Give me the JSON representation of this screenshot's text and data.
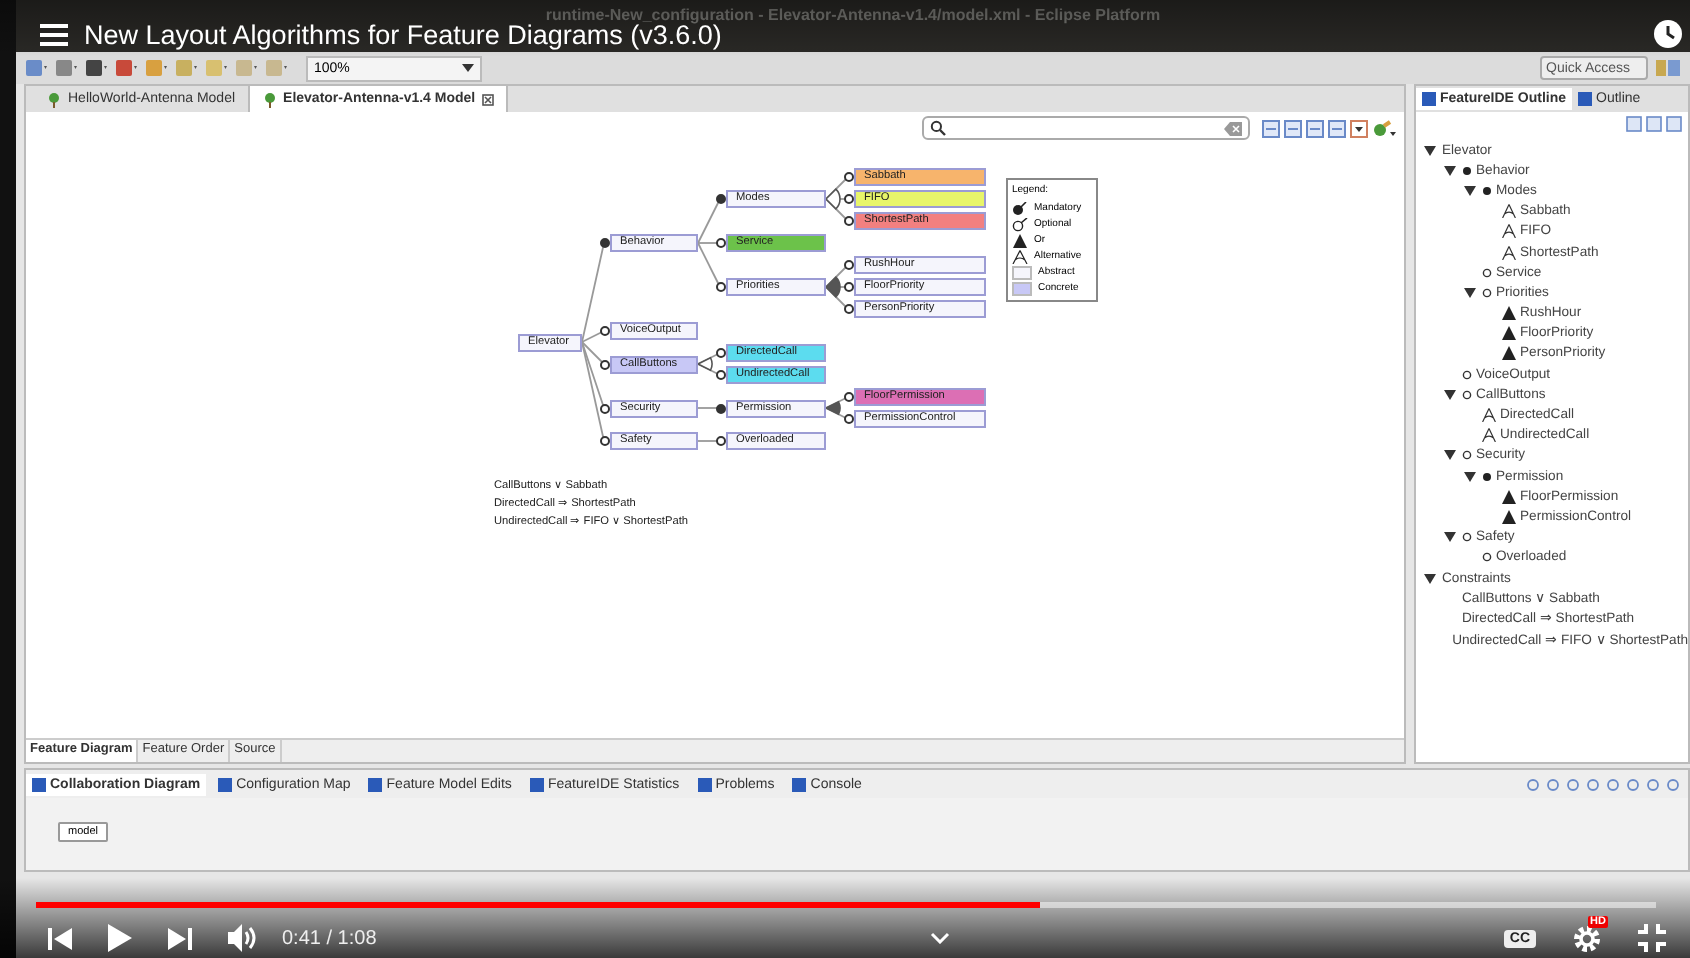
{
  "video": {
    "title": "New Layout Algorithms for Feature Diagrams (v3.6.0)",
    "time": "0:41 / 1:08",
    "progress": {
      "level": 0.62
    },
    "cc": "CC",
    "quality_badge": "HD"
  },
  "window": {
    "title": "runtime-New_configuration - Elevator-Antenna-v1.4/model.xml - Eclipse Platform"
  },
  "toolbar": {
    "zoom": "100%",
    "quick_access": {
      "placeholder": "Quick Access"
    }
  },
  "editor": {
    "tabs": [
      {
        "label": "HelloWorld-Antenna Model",
        "selected": false
      },
      {
        "label": "Elevator-Antenna-v1.4 Model",
        "selected": true
      }
    ],
    "diagram": {
      "root": {
        "name": "Elevator",
        "concrete": false,
        "children": [
          {
            "name": "Behavior",
            "kind": "mandatory",
            "concrete": false,
            "children": [
              {
                "name": "Modes",
                "kind": "mandatory",
                "or_group": false,
                "concrete": false,
                "children": [
                  {
                    "name": "Sabbath",
                    "kind": "optional",
                    "color": "#f7b46c"
                  },
                  {
                    "name": "FIFO",
                    "kind": "optional",
                    "color": "#e8f56a"
                  },
                  {
                    "name": "ShortestPath",
                    "kind": "optional",
                    "color": "#f28080"
                  }
                ]
              },
              {
                "name": "Service",
                "kind": "optional",
                "color": "#6cc24a"
              },
              {
                "name": "Priorities",
                "kind": "optional",
                "or_group": true,
                "concrete": false,
                "children": [
                  {
                    "name": "RushHour",
                    "kind": "optional",
                    "concrete": false
                  },
                  {
                    "name": "FloorPriority",
                    "kind": "optional",
                    "concrete": false
                  },
                  {
                    "name": "PersonPriority",
                    "kind": "optional",
                    "concrete": false
                  }
                ]
              }
            ]
          },
          {
            "name": "VoiceOutput",
            "kind": "optional",
            "concrete": false
          },
          {
            "name": "CallButtons",
            "kind": "optional",
            "or_group": false,
            "concrete": true,
            "children": [
              {
                "name": "DirectedCall",
                "kind": "optional",
                "color": "#5cdcef"
              },
              {
                "name": "UndirectedCall",
                "kind": "optional",
                "color": "#5cdcef"
              }
            ]
          },
          {
            "name": "Security",
            "kind": "optional",
            "concrete": false,
            "children": [
              {
                "name": "Permission",
                "kind": "mandatory",
                "or_group": true,
                "concrete": false,
                "children": [
                  {
                    "name": "FloorPermission",
                    "kind": "optional",
                    "color": "#dc6fb4"
                  },
                  {
                    "name": "PermissionControl",
                    "kind": "optional",
                    "concrete": false
                  }
                ]
              }
            ]
          },
          {
            "name": "Safety",
            "kind": "optional",
            "concrete": false,
            "children": [
              {
                "name": "Overloaded",
                "kind": "optional",
                "concrete": false
              }
            ]
          }
        ]
      },
      "legend": {
        "title": "Legend:",
        "items": [
          {
            "kind": "mandatory",
            "label": "Mandatory"
          },
          {
            "kind": "optional",
            "label": "Optional"
          },
          {
            "kind": "or",
            "label": "Or"
          },
          {
            "kind": "alternative",
            "label": "Alternative"
          },
          {
            "kind": "abstract",
            "label": "Abstract"
          },
          {
            "kind": "concrete",
            "label": "Concrete"
          }
        ]
      },
      "constraints": [
        "CallButtons ∨ Sabbath",
        "DirectedCall ⇒ ShortestPath",
        "UndirectedCall ⇒ FIFO ∨ ShortestPath"
      ]
    },
    "bottom_tabs": [
      {
        "label": "Feature Diagram",
        "selected": true
      },
      {
        "label": "Feature Order",
        "selected": false
      },
      {
        "label": "Source",
        "selected": false
      }
    ]
  },
  "outline": {
    "tabs": [
      {
        "label": "FeatureIDE Outline",
        "selected": true
      },
      {
        "label": "Outline",
        "selected": false
      }
    ],
    "items": [
      {
        "label": "Elevator",
        "expanded": true,
        "children": [
          {
            "label": "Behavior",
            "kind": "mandatory",
            "expanded": true,
            "children": [
              {
                "label": "Modes",
                "kind": "mandatory",
                "expanded": true,
                "children": [
                  {
                    "label": "Sabbath",
                    "kind": "alternative"
                  },
                  {
                    "label": "FIFO",
                    "kind": "alternative"
                  },
                  {
                    "label": "ShortestPath",
                    "kind": "alternative"
                  }
                ]
              },
              {
                "label": "Service",
                "kind": "optional"
              },
              {
                "label": "Priorities",
                "kind": "optional",
                "expanded": true,
                "children": [
                  {
                    "label": "RushHour",
                    "kind": "or"
                  },
                  {
                    "label": "FloorPriority",
                    "kind": "or"
                  },
                  {
                    "label": "PersonPriority",
                    "kind": "or"
                  }
                ]
              }
            ]
          },
          {
            "label": "VoiceOutput",
            "kind": "optional"
          },
          {
            "label": "CallButtons",
            "kind": "optional",
            "expanded": true,
            "children": [
              {
                "label": "DirectedCall",
                "kind": "alternative"
              },
              {
                "label": "UndirectedCall",
                "kind": "alternative"
              }
            ]
          },
          {
            "label": "Security",
            "kind": "optional",
            "expanded": true,
            "children": [
              {
                "label": "Permission",
                "kind": "mandatory",
                "expanded": true,
                "children": [
                  {
                    "label": "FloorPermission",
                    "kind": "or"
                  },
                  {
                    "label": "PermissionControl",
                    "kind": "or"
                  }
                ]
              }
            ]
          },
          {
            "label": "Safety",
            "kind": "optional",
            "expanded": true,
            "children": [
              {
                "label": "Overloaded",
                "kind": "optional"
              }
            ]
          }
        ]
      },
      {
        "label": "Constraints",
        "expanded": true,
        "children": [
          {
            "label": "CallButtons ∨ Sabbath"
          },
          {
            "label": "DirectedCall ⇒ ShortestPath"
          },
          {
            "label": "UndirectedCall ⇒ FIFO ∨ ShortestPath"
          }
        ]
      }
    ]
  },
  "views": {
    "tabs": [
      {
        "label": "Collaboration Diagram",
        "selected": true
      },
      {
        "label": "Configuration Map",
        "selected": false
      },
      {
        "label": "Feature Model Edits",
        "selected": false
      },
      {
        "label": "FeatureIDE Statistics",
        "selected": false
      },
      {
        "label": "Problems",
        "selected": false
      },
      {
        "label": "Console",
        "selected": false
      }
    ],
    "items": [
      "model"
    ]
  }
}
